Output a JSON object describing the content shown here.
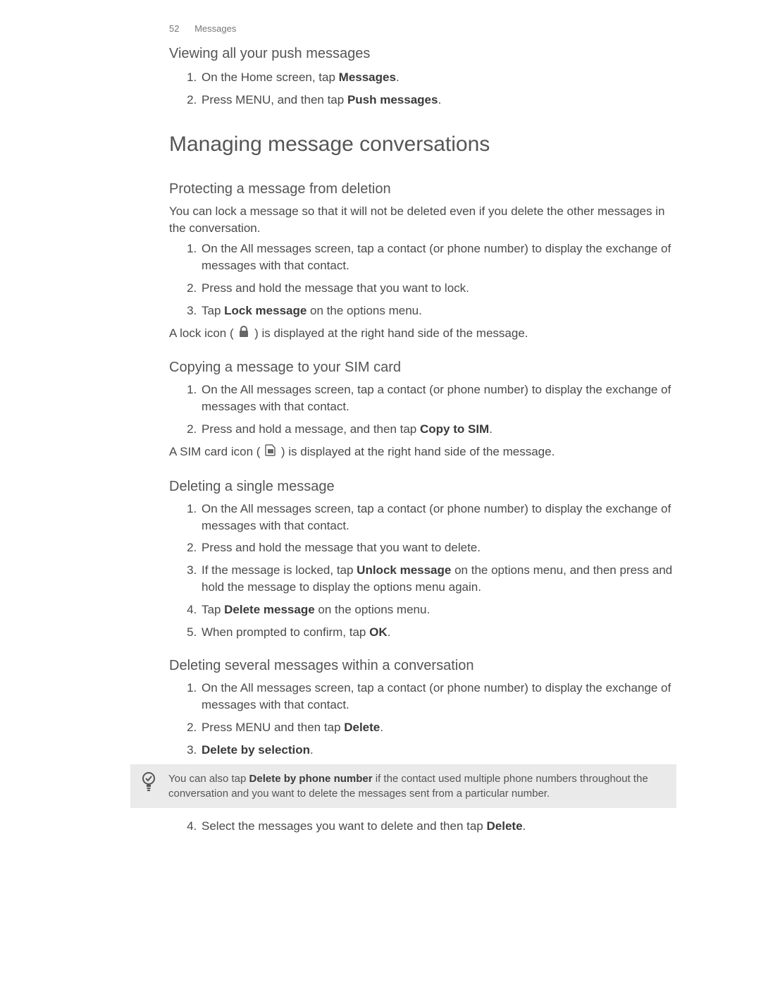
{
  "pageHeader": {
    "number": "52",
    "chapter": "Messages"
  },
  "sec_push": {
    "heading": "Viewing all your push messages",
    "items": [
      {
        "pre": "On the Home screen, tap ",
        "bold": "Messages",
        "post": "."
      },
      {
        "pre": "Press MENU, and then tap ",
        "bold": "Push messages",
        "post": "."
      }
    ]
  },
  "titleManaging": "Managing message conversations",
  "sec_protect": {
    "heading": "Protecting a message from deletion",
    "intro": "You can lock a message so that it will not be deleted even if you delete the other messages in the conversation.",
    "items": [
      {
        "text": "On the All messages screen, tap a contact (or phone number) to display the exchange of messages with that contact."
      },
      {
        "text": "Press and hold the message that you want to lock."
      },
      {
        "pre": "Tap ",
        "bold": "Lock message",
        "post": " on the options menu."
      }
    ],
    "after_pre": "A lock icon ( ",
    "after_post": " ) is displayed at the right hand side of the message."
  },
  "sec_copysim": {
    "heading": "Copying a message to your SIM card",
    "items": [
      {
        "text": "On the All messages screen, tap a contact (or phone number) to display the exchange of messages with that contact."
      },
      {
        "pre": "Press and hold a message, and then tap ",
        "bold": "Copy to SIM",
        "post": "."
      }
    ],
    "after_pre": "A SIM card icon ( ",
    "after_post": " ) is displayed at the right hand side of the message."
  },
  "sec_delete_single": {
    "heading": "Deleting a single message",
    "items": [
      {
        "text": "On the All messages screen, tap a contact (or phone number) to display the exchange of messages with that contact."
      },
      {
        "text": "Press and hold the message that you want to delete."
      },
      {
        "pre": "If the message is locked, tap ",
        "bold": "Unlock message",
        "post": " on the options menu, and then press and hold the message to display the options menu again."
      },
      {
        "pre": "Tap ",
        "bold": "Delete message",
        "post": " on the options menu."
      },
      {
        "pre": "When prompted to confirm, tap ",
        "bold": "OK",
        "post": "."
      }
    ]
  },
  "sec_delete_several": {
    "heading": "Deleting several messages within a conversation",
    "items_a": [
      {
        "text": "On the All messages screen, tap a contact (or phone number) to display the exchange of messages with that contact."
      },
      {
        "pre": "Press MENU and then tap ",
        "bold": "Delete",
        "post": "."
      },
      {
        "bold": "Delete by selection",
        "post": "."
      }
    ],
    "tip_pre": "You can also tap ",
    "tip_bold": "Delete by phone number",
    "tip_post": " if the contact used multiple phone numbers throughout the conversation and you want to delete the messages sent from a particular number.",
    "items_b_start": 4,
    "items_b": [
      {
        "pre": "Select the messages you want to delete and then tap ",
        "bold": "Delete",
        "post": "."
      }
    ]
  }
}
